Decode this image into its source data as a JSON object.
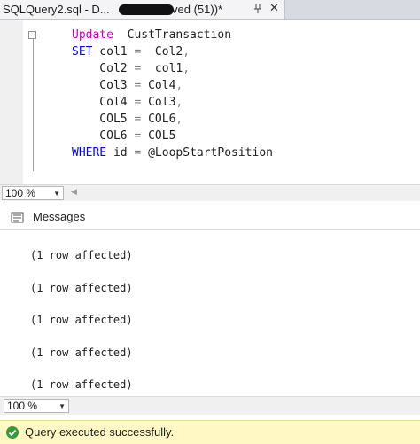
{
  "tab": {
    "title_left": "SQLQuery2.sql - D...",
    "title_right": "ved (51))*",
    "pin_icon": "pin-icon",
    "close_icon": "close-icon"
  },
  "editor": {
    "lines": [
      {
        "parts": [
          {
            "t": "Update",
            "c": "kw-mag"
          },
          {
            "t": "  CustTransaction",
            "c": "plain"
          }
        ]
      },
      {
        "parts": [
          {
            "t": "SET",
            "c": "kw-blue"
          },
          {
            "t": " col1 ",
            "c": "plain"
          },
          {
            "t": "=",
            "c": "gray"
          },
          {
            "t": "  Col2",
            "c": "plain"
          },
          {
            "t": ",",
            "c": "gray"
          }
        ]
      },
      {
        "parts": [
          {
            "t": "    Col2 ",
            "c": "plain"
          },
          {
            "t": "=",
            "c": "gray"
          },
          {
            "t": "  col1",
            "c": "plain"
          },
          {
            "t": ",",
            "c": "gray"
          }
        ]
      },
      {
        "parts": [
          {
            "t": "    Col3 ",
            "c": "plain"
          },
          {
            "t": "=",
            "c": "gray"
          },
          {
            "t": " Col4",
            "c": "plain"
          },
          {
            "t": ",",
            "c": "gray"
          }
        ]
      },
      {
        "parts": [
          {
            "t": "    Col4 ",
            "c": "plain"
          },
          {
            "t": "=",
            "c": "gray"
          },
          {
            "t": " Col3",
            "c": "plain"
          },
          {
            "t": ",",
            "c": "gray"
          }
        ]
      },
      {
        "parts": [
          {
            "t": "    COL5 ",
            "c": "plain"
          },
          {
            "t": "=",
            "c": "gray"
          },
          {
            "t": " COL6",
            "c": "plain"
          },
          {
            "t": ",",
            "c": "gray"
          }
        ]
      },
      {
        "parts": [
          {
            "t": "    COL6 ",
            "c": "plain"
          },
          {
            "t": "=",
            "c": "gray"
          },
          {
            "t": " COL5",
            "c": "plain"
          }
        ]
      },
      {
        "parts": [
          {
            "t": "WHERE",
            "c": "kw-blue"
          },
          {
            "t": " id ",
            "c": "plain"
          },
          {
            "t": "=",
            "c": "gray"
          },
          {
            "t": " @LoopStartPosition",
            "c": "plain"
          }
        ]
      }
    ]
  },
  "zoom_top": {
    "value": "100 %"
  },
  "messages": {
    "tab_label": "Messages",
    "lines": [
      "(1 row affected)",
      "(1 row affected)",
      "(1 row affected)",
      "(1 row affected)",
      "(1 row affected)"
    ]
  },
  "zoom_bottom": {
    "value": "100 %"
  },
  "status": {
    "text": "Query executed successfully.",
    "icon": "success-check-icon"
  },
  "colors": {
    "keyword_magenta": "#c900c9",
    "keyword_blue": "#0000ff",
    "status_bg": "#fff8c4",
    "success": "#3a9a3a"
  }
}
